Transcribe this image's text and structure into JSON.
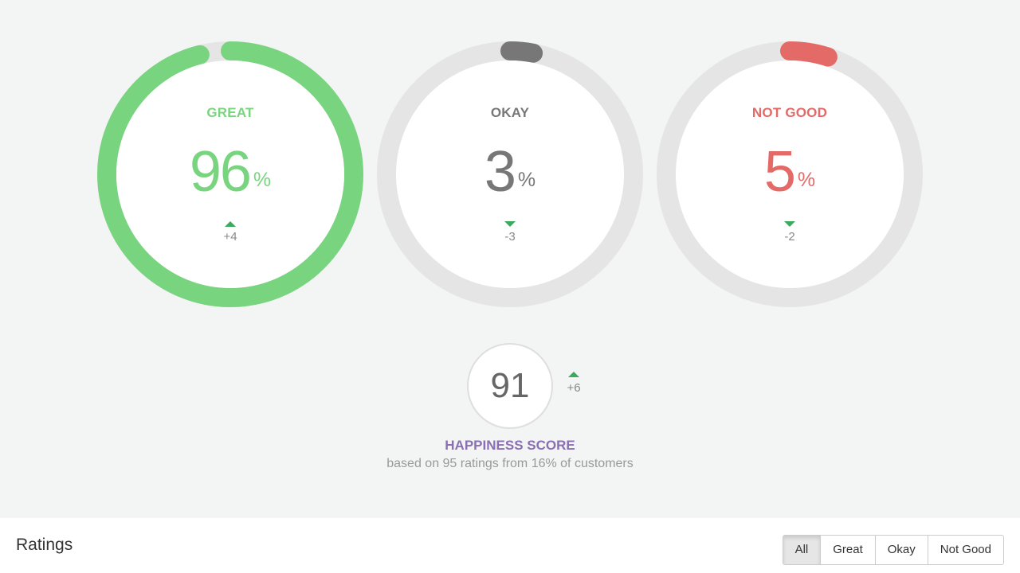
{
  "colors": {
    "great": "#79d47f",
    "okay": "#777777",
    "not_good": "#e46a67",
    "track": "#e5e5e5",
    "trend_arrow": "#3caa5e",
    "happiness": "#8a6fb4"
  },
  "gauges": [
    {
      "label": "GREAT",
      "value": "96",
      "percent": 96,
      "unit": "%",
      "trend": "up",
      "delta": "+4"
    },
    {
      "label": "OKAY",
      "value": "3",
      "percent": 3,
      "unit": "%",
      "trend": "down",
      "delta": "-3"
    },
    {
      "label": "NOT GOOD",
      "value": "5",
      "percent": 5,
      "unit": "%",
      "trend": "down",
      "delta": "-2"
    }
  ],
  "happiness": {
    "score": "91",
    "trend": "up",
    "delta": "+6",
    "title": "HAPPINESS SCORE",
    "subtitle": "based on 95 ratings from 16% of customers"
  },
  "ratings": {
    "title": "Ratings",
    "filters": [
      {
        "label": "All",
        "active": true
      },
      {
        "label": "Great",
        "active": false
      },
      {
        "label": "Okay",
        "active": false
      },
      {
        "label": "Not Good",
        "active": false
      }
    ]
  }
}
